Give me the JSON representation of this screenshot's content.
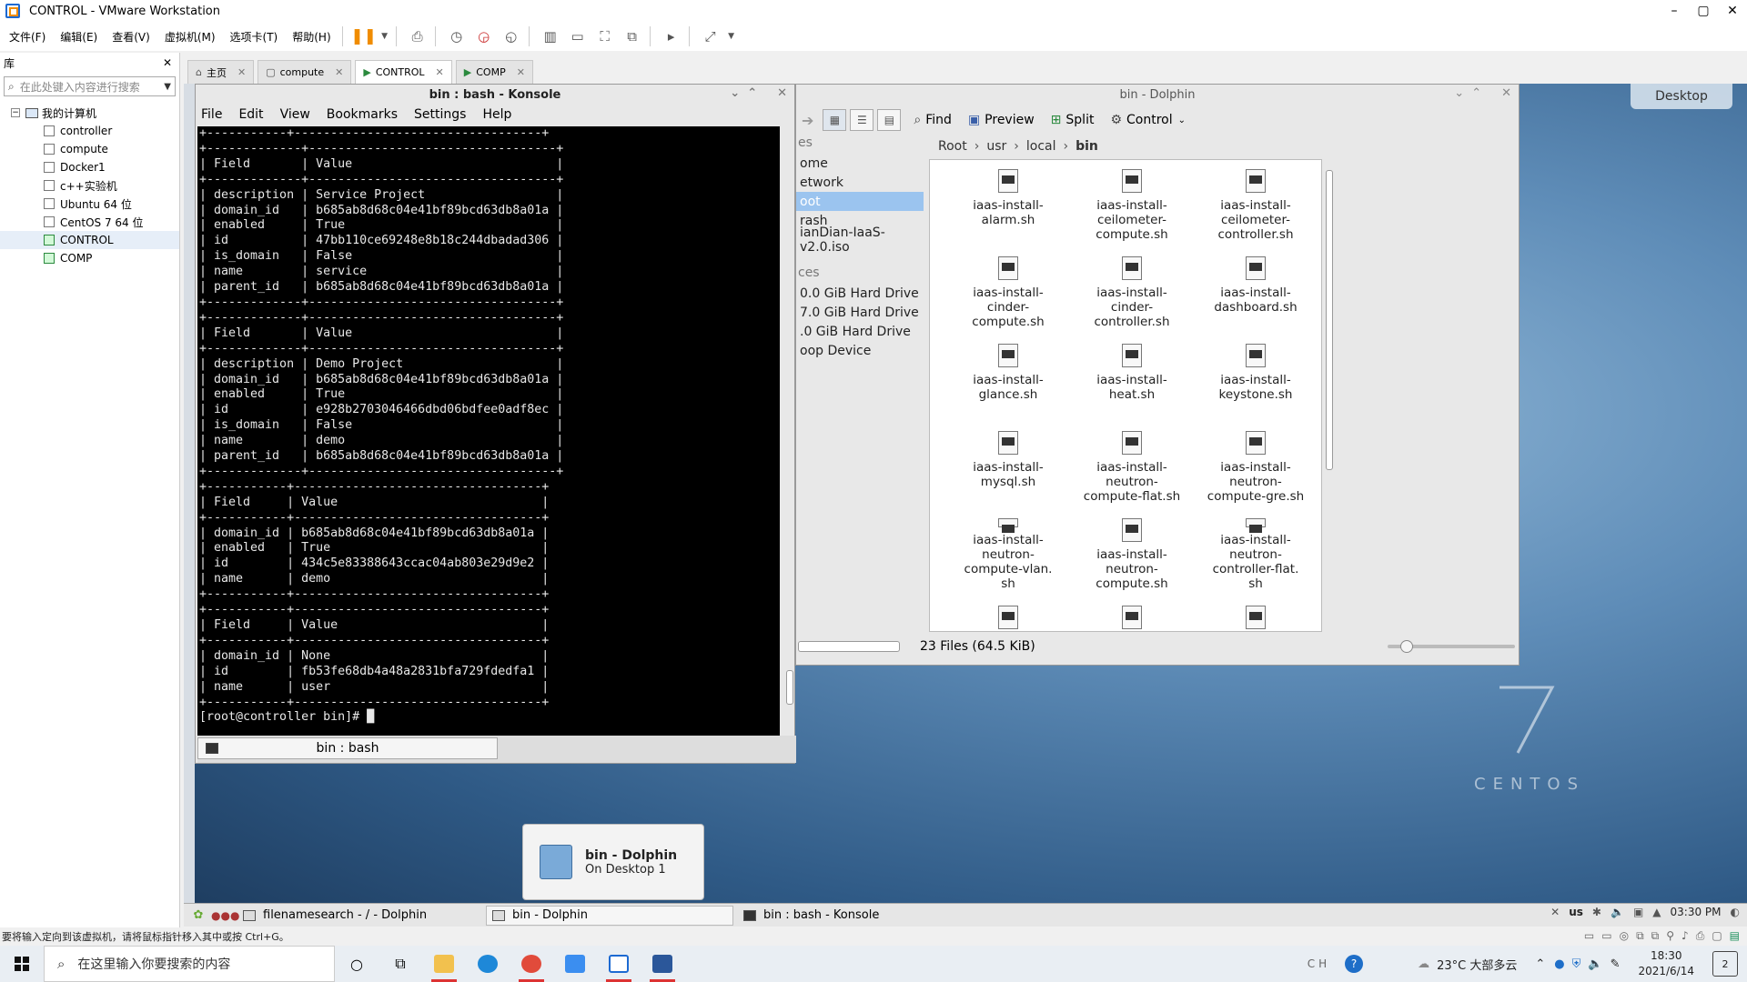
{
  "window": {
    "title": "CONTROL - VMware Workstation"
  },
  "menus": [
    "文件(F)",
    "编辑(E)",
    "查看(V)",
    "虚拟机(M)",
    "选项卡(T)",
    "帮助(H)"
  ],
  "library": {
    "title": "库",
    "search_placeholder": "在此处键入内容进行搜索",
    "root": "我的计算机",
    "vms": [
      "controller",
      "compute",
      "Docker1",
      "c++实验机",
      "Ubuntu 64 位",
      "CentOS 7 64 位",
      "CONTROL",
      "COMP"
    ]
  },
  "tabs": [
    {
      "label": "主页",
      "icon": "home-icon"
    },
    {
      "label": "compute",
      "icon": "vm-icon"
    },
    {
      "label": "CONTROL",
      "icon": "vm-running-icon",
      "active": true
    },
    {
      "label": "COMP",
      "icon": "vm-running-icon"
    }
  ],
  "guest": {
    "desktop_label": "Desktop",
    "centos_text": "CENTOS"
  },
  "konsole": {
    "title": "bin : bash - Konsole",
    "menu": [
      "File",
      "Edit",
      "View",
      "Bookmarks",
      "Settings",
      "Help"
    ],
    "terminal": "+-----------+----------------------------------+\n+-------------+----------------------------------+\n| Field       | Value                            |\n+-------------+----------------------------------+\n| description | Service Project                  |\n| domain_id   | b685ab8d68c04e41bf89bcd63db8a01a |\n| enabled     | True                             |\n| id          | 47bb110ce69248e8b18c244dbadad306 |\n| is_domain   | False                            |\n| name        | service                          |\n| parent_id   | b685ab8d68c04e41bf89bcd63db8a01a |\n+-------------+----------------------------------+\n+-------------+----------------------------------+\n| Field       | Value                            |\n+-------------+----------------------------------+\n| description | Demo Project                     |\n| domain_id   | b685ab8d68c04e41bf89bcd63db8a01a |\n| enabled     | True                             |\n| id          | e928b2703046466dbd06bdfee0adf8ec |\n| is_domain   | False                            |\n| name        | demo                             |\n| parent_id   | b685ab8d68c04e41bf89bcd63db8a01a |\n+-------------+----------------------------------+\n+-----------+----------------------------------+\n| Field     | Value                            |\n+-----------+----------------------------------+\n| domain_id | b685ab8d68c04e41bf89bcd63db8a01a |\n| enabled   | True                             |\n| id        | 434c5e83388643ccac04ab803e29d9e2 |\n| name      | demo                             |\n+-----------+----------------------------------+\n+-----------+----------------------------------+\n| Field     | Value                            |\n+-----------+----------------------------------+\n| domain_id | None                             |\n| id        | fb53fe68db4a48a2831bfa729fdedfa1 |\n| name      | user                             |\n+-----------+----------------------------------+\n[root@controller bin]# █",
    "tab_label": "bin : bash"
  },
  "dolphin": {
    "title": "bin - Dolphin",
    "toolbar": {
      "find": "Find",
      "preview": "Preview",
      "split": "Split",
      "control": "Control"
    },
    "places": {
      "items": [
        "ome",
        "etwork",
        "oot",
        "rash",
        "ianDian-IaaS-v2.0.iso"
      ],
      "devices_head": "ces",
      "devices": [
        "0.0 GiB Hard Drive",
        "7.0 GiB Hard Drive",
        ".0 GiB Hard Drive",
        "oop Device"
      ],
      "head": "es"
    },
    "breadcrumb": [
      "Root",
      "usr",
      "local",
      "bin"
    ],
    "files": [
      "iaas-install-\nalarm.sh",
      "iaas-install-\nceilometer-\ncompute.sh",
      "iaas-install-\nceilometer-\ncontroller.sh",
      "iaas-install-\ncinder-\ncompute.sh",
      "iaas-install-\ncinder-\ncontroller.sh",
      "iaas-install-\ndashboard.sh",
      "iaas-install-\nglance.sh",
      "iaas-install-\nheat.sh",
      "iaas-install-\nkeystone.sh",
      "iaas-install-\nmysql.sh",
      "iaas-install-\nneutron-\ncompute-flat.sh",
      "iaas-install-\nneutron-\ncompute-gre.sh",
      "iaas-install-\nneutron-\ncompute-vlan.\nsh",
      "iaas-install-\nneutron-\ncompute.sh",
      "iaas-install-\nneutron-\ncontroller-flat.\nsh",
      "",
      "",
      ""
    ],
    "status": "23 Files (64.5 KiB)"
  },
  "notification": {
    "title": "bin - Dolphin",
    "subtitle": "On Desktop 1"
  },
  "guest_panel": {
    "tasks": [
      "filenamesearch - / - Dolphin",
      "bin - Dolphin",
      "bin : bash - Konsole"
    ],
    "lang": "us",
    "time": "03:30 PM"
  },
  "vm_status": "要将输入定向到该虚拟机，请将鼠标指针移入其中或按 Ctrl+G。",
  "taskbar": {
    "search_placeholder": "在这里输入你要搜索的内容",
    "weather": "23°C 大部多云",
    "ime": "CH",
    "time": "18:30",
    "date": "2021/6/14",
    "notif_count": "2"
  }
}
